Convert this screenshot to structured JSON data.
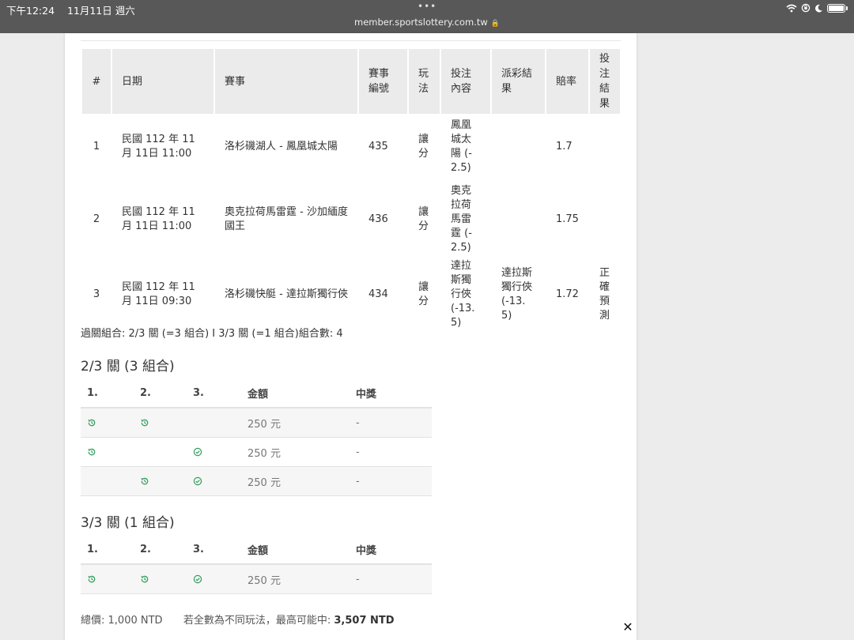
{
  "status_bar": {
    "time": "下午12:24",
    "date": "11月11日 週六",
    "url": "member.sportslottery.com.tw",
    "dots": "•••"
  },
  "bets_table": {
    "headers": [
      "#",
      "日期",
      "賽事",
      "賽事編號",
      "玩法",
      "投注內容",
      "派彩結果",
      "賠率",
      "投注結果"
    ],
    "rows": [
      {
        "num": "1",
        "date": "民國 112 年 11月 11日 11:00",
        "match": "洛杉磯湖人 - 鳳凰城太陽",
        "match_id": "435",
        "play": "讓分",
        "content": "鳳凰城太陽 (-2.5)",
        "payout": "",
        "odds": "1.7",
        "result": ""
      },
      {
        "num": "2",
        "date": "民國 112 年 11月 11日 11:00",
        "match": "奧克拉荷馬雷霆 - 沙加緬度國王",
        "match_id": "436",
        "play": "讓分",
        "content": "奧克拉荷馬雷霆 (-2.5)",
        "payout": "",
        "odds": "1.75",
        "result": ""
      },
      {
        "num": "3",
        "date": "民國 112 年 11月 11日 09:30",
        "match": "洛杉磯快艇 - 達拉斯獨行俠",
        "match_id": "434",
        "play": "讓分",
        "content": "達拉斯獨行俠 (-13.5)",
        "payout": "達拉斯獨行俠 (-13.5)",
        "odds": "1.72",
        "result": "正確預測"
      }
    ]
  },
  "combo_summary": "過關組合: 2/3 關 (=3 組合) I 3/3 關 (=1 組合)組合數: 4",
  "section_2of3": {
    "title": "2/3 關 (3 組合)",
    "headers": [
      "1.",
      "2.",
      "3.",
      "金額",
      "中獎"
    ],
    "rows": [
      {
        "icons": [
          "clock-icon",
          "clock-icon",
          ""
        ],
        "amount": "250 元",
        "prize": "-"
      },
      {
        "icons": [
          "clock-icon",
          "",
          "check-icon"
        ],
        "amount": "250 元",
        "prize": "-"
      },
      {
        "icons": [
          "",
          "clock-icon",
          "check-icon"
        ],
        "amount": "250 元",
        "prize": "-"
      }
    ]
  },
  "section_3of3": {
    "title": "3/3 關 (1 組合)",
    "headers": [
      "1.",
      "2.",
      "3.",
      "金額",
      "中獎"
    ],
    "rows": [
      {
        "icons": [
          "clock-icon",
          "clock-icon",
          "check-icon"
        ],
        "amount": "250 元",
        "prize": "-"
      }
    ]
  },
  "footer": {
    "total_label": "總價:",
    "total_value": "1,000 NTD",
    "max_label": "若全數為不同玩法，最高可能中:",
    "max_value": "3,507 NTD"
  },
  "colors": {
    "status_bar_bg": "#585858",
    "header_bg": "#ebebeb",
    "icon_green": "#2e9e5b",
    "page_bg": "#ececec"
  },
  "close_label": "✕"
}
